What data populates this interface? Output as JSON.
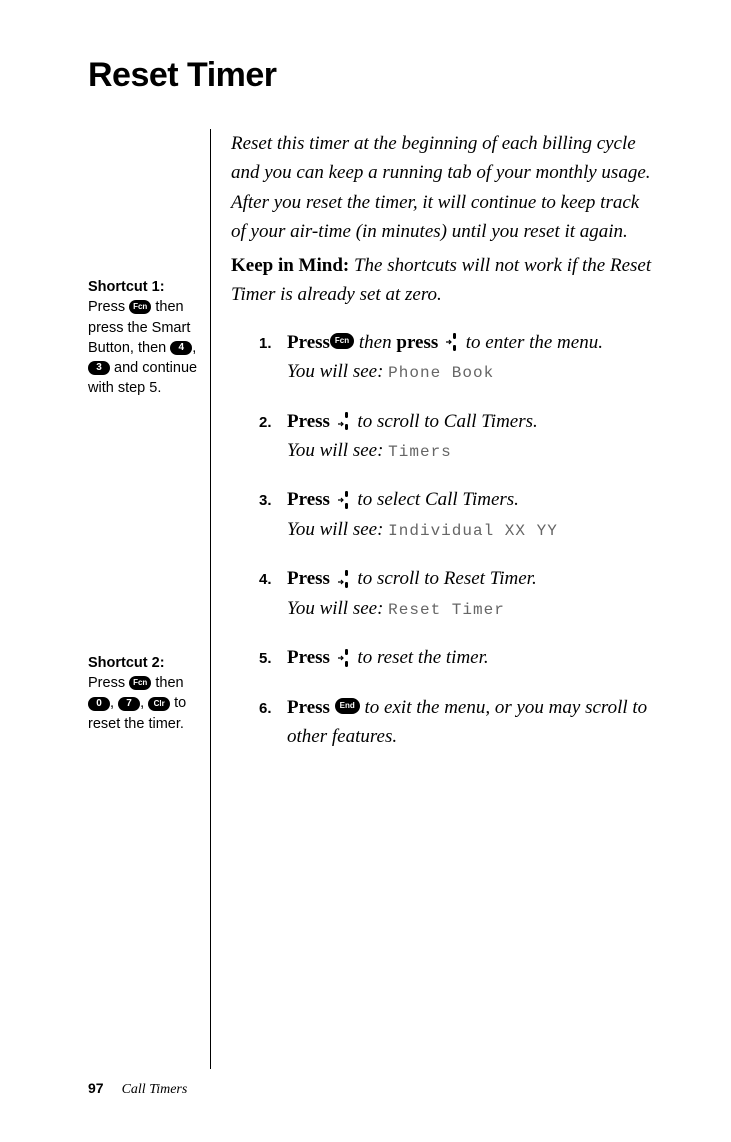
{
  "title": "Reset Timer",
  "intro": "Reset this timer at the beginning of each billing cycle and you can keep a running tab of your monthly usage. After you reset the timer, it will continue to keep track of your air-time (in minutes) until you reset it again.",
  "keep_in_mind": {
    "label": "Keep in Mind:",
    "text": " The shortcuts will not work if the Reset Timer is already set at zero."
  },
  "sidebar": {
    "shortcut1": {
      "title": "Shortcut 1:",
      "pre": "Press ",
      "fcn": "Fcn",
      "mid1": " then press the Smart Button, then ",
      "k4": "4",
      "sep": ", ",
      "k3": "3",
      "tail": " and continue with step 5."
    },
    "shortcut2": {
      "title": "Shortcut 2:",
      "pre": "Press ",
      "fcn": "Fcn",
      "mid": " then ",
      "k0": "0",
      "sep1": ", ",
      "k7": "7",
      "sep2": ", ",
      "clr": "Clr",
      "tail": " to reset the timer."
    }
  },
  "steps": [
    {
      "num": "1.",
      "press": "Press",
      "fcn": "Fcn",
      "mid": " then ",
      "press2": "press",
      "nav": "right",
      "tail": " to enter the menu.",
      "see_label": "You will see: ",
      "see_lcd": "Phone Book"
    },
    {
      "num": "2.",
      "press": "Press",
      "nav": "down",
      "tail": " to scroll to Call Timers.",
      "see_label": "You will see: ",
      "see_lcd": "Timers"
    },
    {
      "num": "3.",
      "press": "Press",
      "nav": "right",
      "tail": " to select Call Timers.",
      "see_label": "You will see: ",
      "see_lcd": "Individual XX YY"
    },
    {
      "num": "4.",
      "press": "Press",
      "nav": "down",
      "tail": " to scroll to Reset Timer.",
      "see_label": "You will see: ",
      "see_lcd": "Reset Timer"
    },
    {
      "num": "5.",
      "press": "Press",
      "nav": "right",
      "tail": " to reset the timer."
    },
    {
      "num": "6.",
      "press": "Press",
      "end": "End",
      "tail": " to exit the menu, or you may scroll to other features."
    }
  ],
  "footer": {
    "page": "97",
    "section": "Call Timers"
  }
}
